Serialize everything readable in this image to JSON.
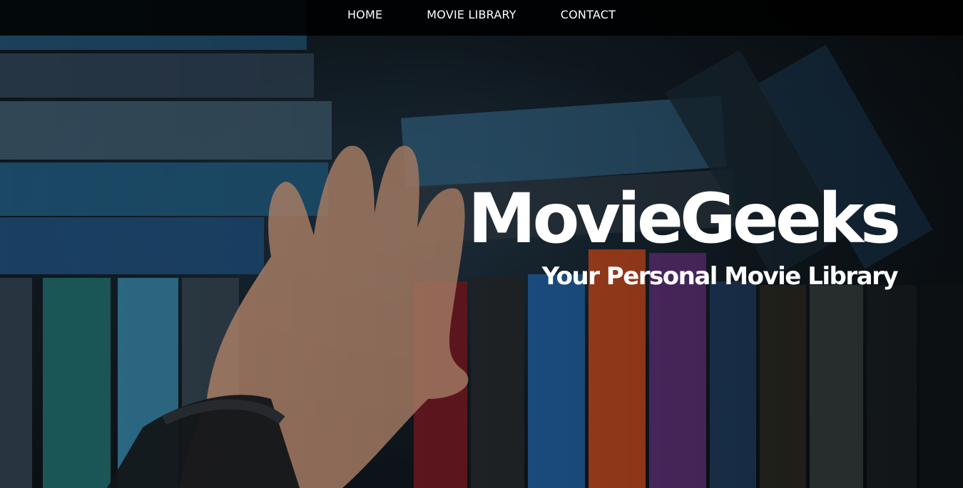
{
  "nav": {
    "items": [
      {
        "label": "HOME"
      },
      {
        "label": "MOVIE LIBRARY"
      },
      {
        "label": "CONTACT"
      }
    ]
  },
  "hero": {
    "title": "MovieGeeks",
    "subtitle": "Your Personal Movie Library",
    "background_image": "hand-browsing-vhs-tapes-photo"
  },
  "colors": {
    "nav_background": "#000000",
    "text": "#ffffff",
    "backdrop_dark": "#0a0d10",
    "backdrop_teal": "#1f3341"
  }
}
